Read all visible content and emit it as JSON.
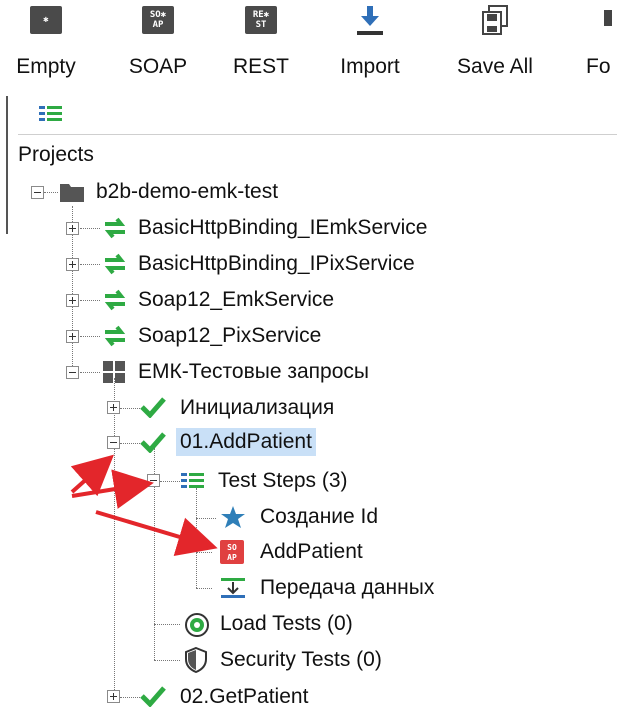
{
  "toolbar": {
    "buttons": [
      {
        "label": "Empty",
        "icon": "empty-project-icon"
      },
      {
        "label": "SOAP",
        "icon": "soap-icon",
        "glyph": "SO✱\nAP"
      },
      {
        "label": "REST",
        "icon": "rest-icon",
        "glyph": "RE✱\nST"
      },
      {
        "label": "Import",
        "icon": "import-icon"
      },
      {
        "label": "Save All",
        "icon": "save-all-icon"
      },
      {
        "label": "Fo",
        "icon": "forum-icon"
      }
    ]
  },
  "navigator": {
    "root_label": "Projects",
    "project": "b2b-demo-emk-test",
    "interfaces": [
      "BasicHttpBinding_IEmkService",
      "BasicHttpBinding_IPixService",
      "Soap12_EmkService",
      "Soap12_PixService"
    ],
    "test_suite": "ЕМК-Тестовые запросы",
    "test_cases": {
      "init": "Инициализация",
      "add_patient": "01.AddPatient",
      "get_patient": "02.GetPatient"
    },
    "test_steps_label": "Test Steps (3)",
    "steps": [
      "Создание Id",
      "AddPatient",
      "Передача данных"
    ],
    "load_tests": "Load Tests (0)",
    "security_tests": "Security Tests (0)"
  },
  "colors": {
    "selection": "#c9e0f7",
    "green": "#2eaa43",
    "arrow_red": "#e3262b",
    "soap_red": "#e04040",
    "star_blue": "#2f7fb8"
  }
}
